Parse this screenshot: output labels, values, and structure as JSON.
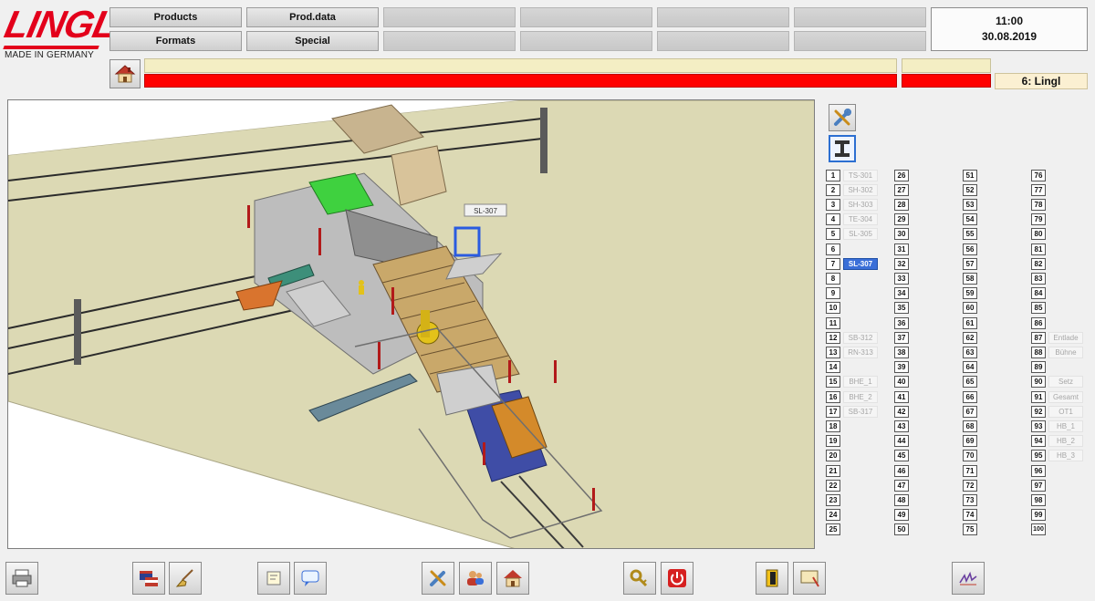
{
  "logo": {
    "word": "LINGL",
    "tagline": "MADE IN GERMANY"
  },
  "menu": {
    "row1": [
      "Products",
      "Prod.data",
      "",
      "",
      "",
      ""
    ],
    "row2": [
      "Formats",
      "Special",
      "",
      "",
      "",
      ""
    ]
  },
  "clock": {
    "time": "11:00",
    "date": "30.08.2019"
  },
  "status": {
    "user": "6: Lingl"
  },
  "colors": {
    "accent_red": "#e3001b",
    "alarm_red": "#ff0000",
    "status_yellow": "#f4eec4",
    "active_blue": "#3a6fd8",
    "floor": "#dcd9b4"
  },
  "view": {
    "tag_label": "SL-307"
  },
  "tools": [
    {
      "icon": "wrench-screwdriver-icon"
    },
    {
      "icon": "i-beam-icon"
    }
  ],
  "stations": {
    "col1": [
      {
        "n": "1",
        "label": "TS-301"
      },
      {
        "n": "2",
        "label": "SH-302"
      },
      {
        "n": "3",
        "label": "SH-303"
      },
      {
        "n": "4",
        "label": "TE-304"
      },
      {
        "n": "5",
        "label": "SL-305"
      },
      {
        "n": "6",
        "label": ""
      },
      {
        "n": "7",
        "label": "SL-307",
        "active": true
      },
      {
        "n": "8",
        "label": ""
      },
      {
        "n": "9",
        "label": ""
      },
      {
        "n": "10",
        "label": ""
      },
      {
        "n": "11",
        "label": ""
      },
      {
        "n": "12",
        "label": "SB-312"
      },
      {
        "n": "13",
        "label": "RN-313"
      },
      {
        "n": "14",
        "label": ""
      },
      {
        "n": "15",
        "label": "BHE_1"
      },
      {
        "n": "16",
        "label": "BHE_2"
      },
      {
        "n": "17",
        "label": "SB-317"
      },
      {
        "n": "18",
        "label": ""
      },
      {
        "n": "19",
        "label": ""
      },
      {
        "n": "20",
        "label": ""
      },
      {
        "n": "21",
        "label": ""
      },
      {
        "n": "22",
        "label": ""
      },
      {
        "n": "23",
        "label": ""
      },
      {
        "n": "24",
        "label": ""
      },
      {
        "n": "25",
        "label": ""
      }
    ],
    "col2": [
      {
        "n": "26"
      },
      {
        "n": "27"
      },
      {
        "n": "28"
      },
      {
        "n": "29"
      },
      {
        "n": "30"
      },
      {
        "n": "31"
      },
      {
        "n": "32"
      },
      {
        "n": "33"
      },
      {
        "n": "34"
      },
      {
        "n": "35"
      },
      {
        "n": "36"
      },
      {
        "n": "37"
      },
      {
        "n": "38"
      },
      {
        "n": "39"
      },
      {
        "n": "40"
      },
      {
        "n": "41"
      },
      {
        "n": "42"
      },
      {
        "n": "43"
      },
      {
        "n": "44"
      },
      {
        "n": "45"
      },
      {
        "n": "46"
      },
      {
        "n": "47"
      },
      {
        "n": "48"
      },
      {
        "n": "49"
      },
      {
        "n": "50"
      }
    ],
    "col3": [
      {
        "n": "51"
      },
      {
        "n": "52"
      },
      {
        "n": "53"
      },
      {
        "n": "54"
      },
      {
        "n": "55"
      },
      {
        "n": "56"
      },
      {
        "n": "57"
      },
      {
        "n": "58"
      },
      {
        "n": "59"
      },
      {
        "n": "60"
      },
      {
        "n": "61"
      },
      {
        "n": "62"
      },
      {
        "n": "63"
      },
      {
        "n": "64"
      },
      {
        "n": "65"
      },
      {
        "n": "66"
      },
      {
        "n": "67"
      },
      {
        "n": "68"
      },
      {
        "n": "69"
      },
      {
        "n": "70"
      },
      {
        "n": "71"
      },
      {
        "n": "72"
      },
      {
        "n": "73"
      },
      {
        "n": "74"
      },
      {
        "n": "75"
      }
    ],
    "col4": [
      {
        "n": "76",
        "label": ""
      },
      {
        "n": "77",
        "label": ""
      },
      {
        "n": "78",
        "label": ""
      },
      {
        "n": "79",
        "label": ""
      },
      {
        "n": "80",
        "label": ""
      },
      {
        "n": "81",
        "label": ""
      },
      {
        "n": "82",
        "label": ""
      },
      {
        "n": "83",
        "label": ""
      },
      {
        "n": "84",
        "label": ""
      },
      {
        "n": "85",
        "label": ""
      },
      {
        "n": "86",
        "label": ""
      },
      {
        "n": "87",
        "label": "Entlade"
      },
      {
        "n": "88",
        "label": "Bühne"
      },
      {
        "n": "89",
        "label": ""
      },
      {
        "n": "90",
        "label": "Setz"
      },
      {
        "n": "91",
        "label": "Gesamt"
      },
      {
        "n": "92",
        "label": "OT1"
      },
      {
        "n": "93",
        "label": "HB_1"
      },
      {
        "n": "94",
        "label": "HB_2"
      },
      {
        "n": "95",
        "label": "HB_3"
      },
      {
        "n": "96",
        "label": ""
      },
      {
        "n": "97",
        "label": ""
      },
      {
        "n": "98",
        "label": ""
      },
      {
        "n": "99",
        "label": ""
      },
      {
        "n": "100",
        "label": ""
      }
    ]
  },
  "bottom_toolbar": [
    "printer-icon",
    "flag-language-icon",
    "broom-clean-icon",
    "note-edit-icon",
    "chat-bubble-icon",
    "tools-icon",
    "users-icon",
    "home-icon",
    "key-icon",
    "power-icon",
    "door-exit-icon",
    "monitor-edit-icon",
    "signature-icon"
  ]
}
